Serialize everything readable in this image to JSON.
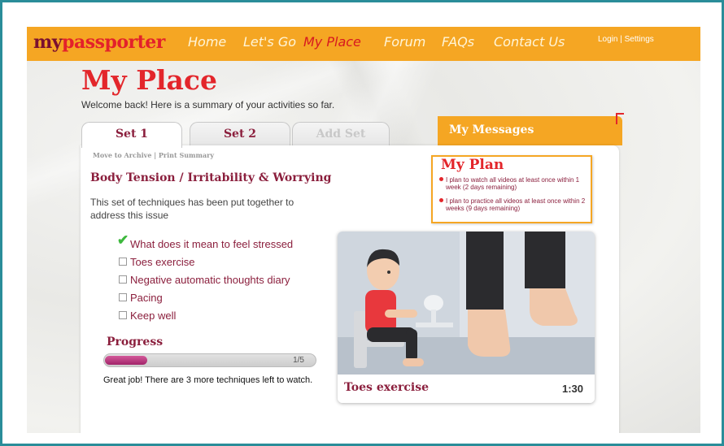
{
  "brand": {
    "part1": "my",
    "part2": "passporter"
  },
  "nav": {
    "items": [
      {
        "label": "Home",
        "active": false
      },
      {
        "label": "Let's Go",
        "active": false
      },
      {
        "label": "My Place",
        "active": true
      },
      {
        "label": "Forum",
        "active": false
      },
      {
        "label": "FAQs",
        "active": false
      },
      {
        "label": "Contact Us",
        "active": false
      }
    ],
    "login": "Login | Settings"
  },
  "page": {
    "title": "My Place",
    "welcome": "Welcome back! Here is a summary of your activities so far."
  },
  "tabs": [
    {
      "label": "Set 1",
      "active": true
    },
    {
      "label": "Set 2",
      "active": false
    },
    {
      "label": "Add Set",
      "disabled": true
    }
  ],
  "set": {
    "actions": "Move to Archive | Print Summary",
    "title": "Body Tension / Irritability & Worrying",
    "description": "This set of techniques has been put together to address this issue",
    "techniques": [
      {
        "label": "What does it mean to feel stressed",
        "done": true
      },
      {
        "label": "Toes exercise",
        "done": false
      },
      {
        "label": "Negative automatic thoughts diary",
        "done": false
      },
      {
        "label": "Pacing",
        "done": false
      },
      {
        "label": "Keep well",
        "done": false
      }
    ],
    "progress": {
      "label": "Progress",
      "completed": 1,
      "total": 5,
      "count_text": "1/5",
      "note": "Great job! There are 3 more techniques left to watch."
    }
  },
  "messages": {
    "title": "My Messages"
  },
  "plan": {
    "title": "My Plan",
    "items": [
      {
        "text": "I plan to watch all videos  at least once within 1 week",
        "remaining": "(2 days remaining)"
      },
      {
        "text": "I plan to practice all videos at least once within 2 weeks",
        "remaining": "(9 days remaining)"
      }
    ]
  },
  "video": {
    "title": "Toes exercise",
    "duration": "1:30"
  },
  "colors": {
    "nav_orange": "#f5a623",
    "title_red": "#e3262b",
    "maroon": "#8b1f3d",
    "check_green": "#3db83d",
    "frame_teal": "#2a8d99"
  }
}
